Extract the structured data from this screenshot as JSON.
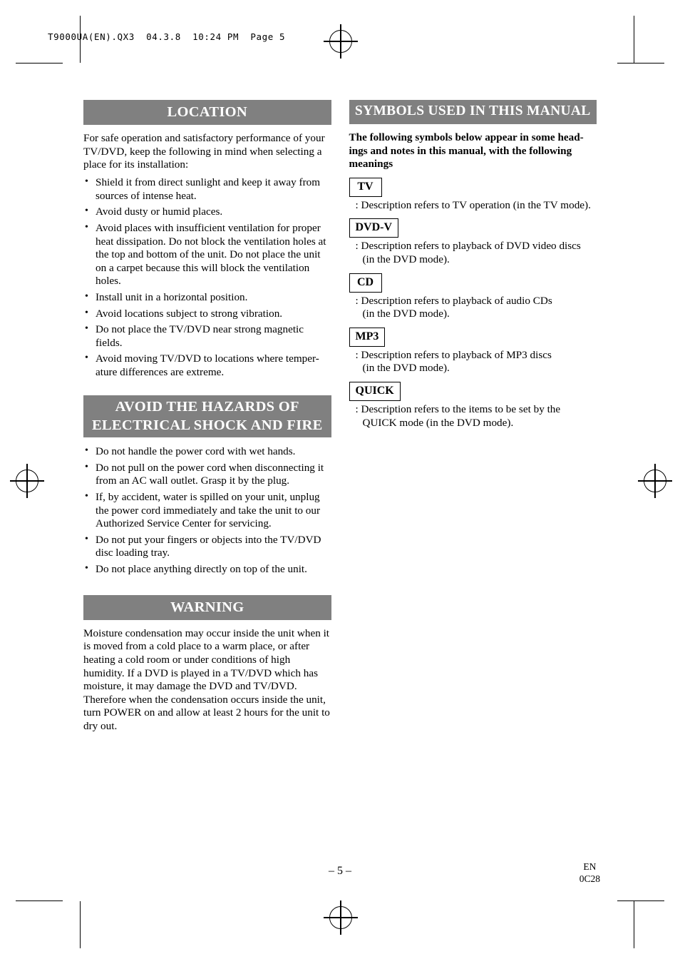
{
  "slug": "T9000UA(EN).QX3  04.3.8  10:24 PM  Page 5",
  "colors": {
    "heading_bar": "#808080",
    "heading_text": "#ffffff",
    "text": "#000000"
  },
  "left_column": {
    "location": {
      "heading": "LOCATION",
      "intro": "For safe operation and satisfactory performance of your TV/DVD, keep the following in mind when selecting a place for its installation:",
      "bullets": [
        "Shield it from direct sunlight and keep it away from sources of intense heat.",
        "Avoid dusty or humid places.",
        "Avoid places with insufficient ventilation for proper heat dissipation. Do not block the ventilation holes at the top and bottom of the unit. Do not place the unit on a carpet because this will block the ventilation holes.",
        "Install unit in a horizontal position.",
        "Avoid locations subject to strong vibration.",
        "Do not place the TV/DVD near strong magnetic fields.",
        "Avoid moving TV/DVD to locations where temper-ature differences are extreme."
      ]
    },
    "hazards": {
      "heading_line1": "AVOID THE HAZARDS OF",
      "heading_line2": "ELECTRICAL SHOCK AND FIRE",
      "bullets": [
        "Do not handle the power cord with wet hands.",
        "Do not pull on the power cord when disconnecting it from an AC wall outlet. Grasp it by the plug.",
        "If, by accident, water is spilled on your unit, unplug the power cord immediately and take the unit to our Authorized Service Center for servicing.",
        "Do not put your fingers or objects into the TV/DVD disc loading tray.",
        "Do not place anything directly on top of the unit."
      ]
    },
    "warning": {
      "heading": "WARNING",
      "text": "Moisture condensation may occur inside the unit when it is moved from a cold place to a warm place, or after heating a cold room or under conditions of high humidity. If a DVD is played in a TV/DVD which has moisture, it may damage the DVD and TV/DVD. Therefore when the condensation occurs inside the unit, turn POWER on and allow at least 2 hours for the unit to dry out."
    }
  },
  "right_column": {
    "symbols": {
      "heading": "SYMBOLS USED IN THIS MANUAL",
      "intro": "The following symbols below appear in some head-ings and notes in this manual, with the following meanings",
      "items": [
        {
          "badge": "TV",
          "desc": ": Description refers to TV operation (in the TV mode).",
          "desc_cont": ""
        },
        {
          "badge": "DVD-V",
          "desc": ": Description refers to playback of DVD video discs",
          "desc_cont": "(in the DVD mode)."
        },
        {
          "badge": "CD",
          "desc": ": Description refers to playback of audio CDs",
          "desc_cont": "(in the DVD mode)."
        },
        {
          "badge": "MP3",
          "desc": ": Description refers to playback of MP3 discs",
          "desc_cont": "(in the DVD mode)."
        },
        {
          "badge": "QUICK",
          "desc": ": Description refers to the items to be set by the",
          "desc_cont": "QUICK mode (in the DVD mode)."
        }
      ]
    }
  },
  "footer": {
    "page_number": "– 5 –",
    "code_line1": "EN",
    "code_line2": "0C28"
  }
}
